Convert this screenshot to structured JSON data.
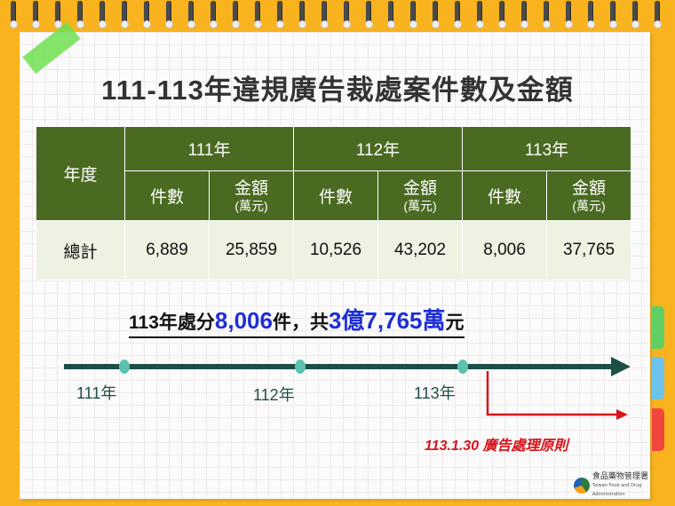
{
  "title": "111-113年違規廣告裁處案件數及金額",
  "table": {
    "row_header": "年度",
    "years": [
      "111年",
      "112年",
      "113年"
    ],
    "sub_count": "件數",
    "sub_amount": "金額",
    "sub_amount_unit": "(萬元)",
    "total_label": "總計",
    "values": [
      "6,889",
      "25,859",
      "10,526",
      "43,202",
      "8,006",
      "37,765"
    ]
  },
  "summary": {
    "prefix": "113年處分",
    "cases": "8,006",
    "middle": "件，共",
    "amount": "3億7,765萬",
    "suffix": "元"
  },
  "timeline": {
    "labels": [
      "111年",
      "112年",
      "113年"
    ],
    "principle_label": "113.1.30 廣告處理原則"
  },
  "logo": {
    "name": "食品藥物管理署",
    "sub": "Taiwan Food and Drug Administration"
  },
  "colors": {
    "background": "#f8b31f",
    "table_header": "#4a6a22",
    "table_body": "#edf2e3",
    "highlight_blue": "#1e2fd6",
    "timeline": "#1d4f47",
    "marker": "#5cc2ae",
    "red": "#d8141b"
  }
}
